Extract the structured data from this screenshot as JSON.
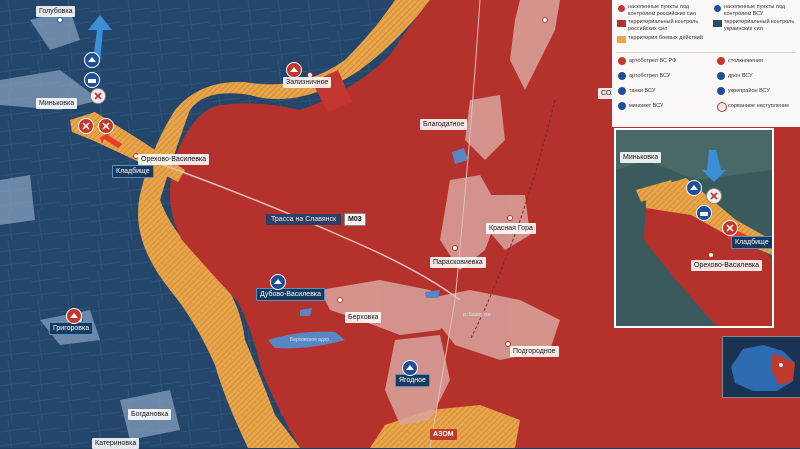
{
  "map": {
    "towns": {
      "golubovka": "Голубовка",
      "minkovka": "Миньковка",
      "zalizhnichnoe": "Зализничное",
      "blagodatnoe": "Благодатное",
      "sol": "СОЛ",
      "orekhovo": "Орехово-Василевка",
      "kladbishche": "Кладбище",
      "krasnaya_gora": "Красная Гора",
      "paraskovievka": "Парасковиевка",
      "dubovo": "Дубово-Василевка",
      "berkhovka": "Берховка",
      "grigorovka": "Григоровка",
      "podgorodnoe": "Подгородное",
      "yagodnoe": "Ягодное",
      "bogdanovka": "Богдановка",
      "azom": "АЗОМ",
      "katerinovka": "Катериновка"
    },
    "road_label": "Трасса на Славянск",
    "road_code": "М03",
    "river_label": "р. Бахмутка",
    "reservoir_label": "Берховское вдхр."
  },
  "legend": {
    "items": [
      {
        "label": "населенные пункты под контролем российских сил",
        "color": "#c0392b",
        "kind": "dot"
      },
      {
        "label": "населенные пункты под контролем ВСУ",
        "color": "#1d4f9c",
        "kind": "dot"
      },
      {
        "label": "территориальный контроль российских сил",
        "color": "#b5312b",
        "kind": "sq"
      },
      {
        "label": "территориальный контроль украинских сил",
        "color": "#2a4a6e",
        "kind": "sq"
      },
      {
        "label": "территория боевых действий",
        "color": "#e8a54a",
        "kind": "sq"
      },
      {
        "label": "артобстрел ВС РФ",
        "kind": "ico-ru"
      },
      {
        "label": "столкновения",
        "kind": "ico-clash"
      },
      {
        "label": "артобстрел ВСУ",
        "kind": "ico-ua"
      },
      {
        "label": "дрон ВСУ",
        "kind": "ico-drone"
      },
      {
        "label": "танки ВСУ",
        "kind": "ico-tank"
      },
      {
        "label": "укрепрайон ВСУ",
        "kind": "ico-fort"
      },
      {
        "label": "миномет ВСУ",
        "kind": "ico-mortar"
      },
      {
        "label": "сорванное наступление",
        "kind": "ico-x"
      }
    ]
  },
  "inset": {
    "minkovka": "Миньковка",
    "kladbishche": "Кладбище",
    "orekhovo": "Орехово-Василевка"
  },
  "colors": {
    "ru_territory": "#b5312b",
    "ua_territory": "#2a4a6e",
    "combat_zone": "#e8a54a",
    "ua_arrow": "#3a8fd8",
    "ru_arrow": "#e63b2e"
  }
}
